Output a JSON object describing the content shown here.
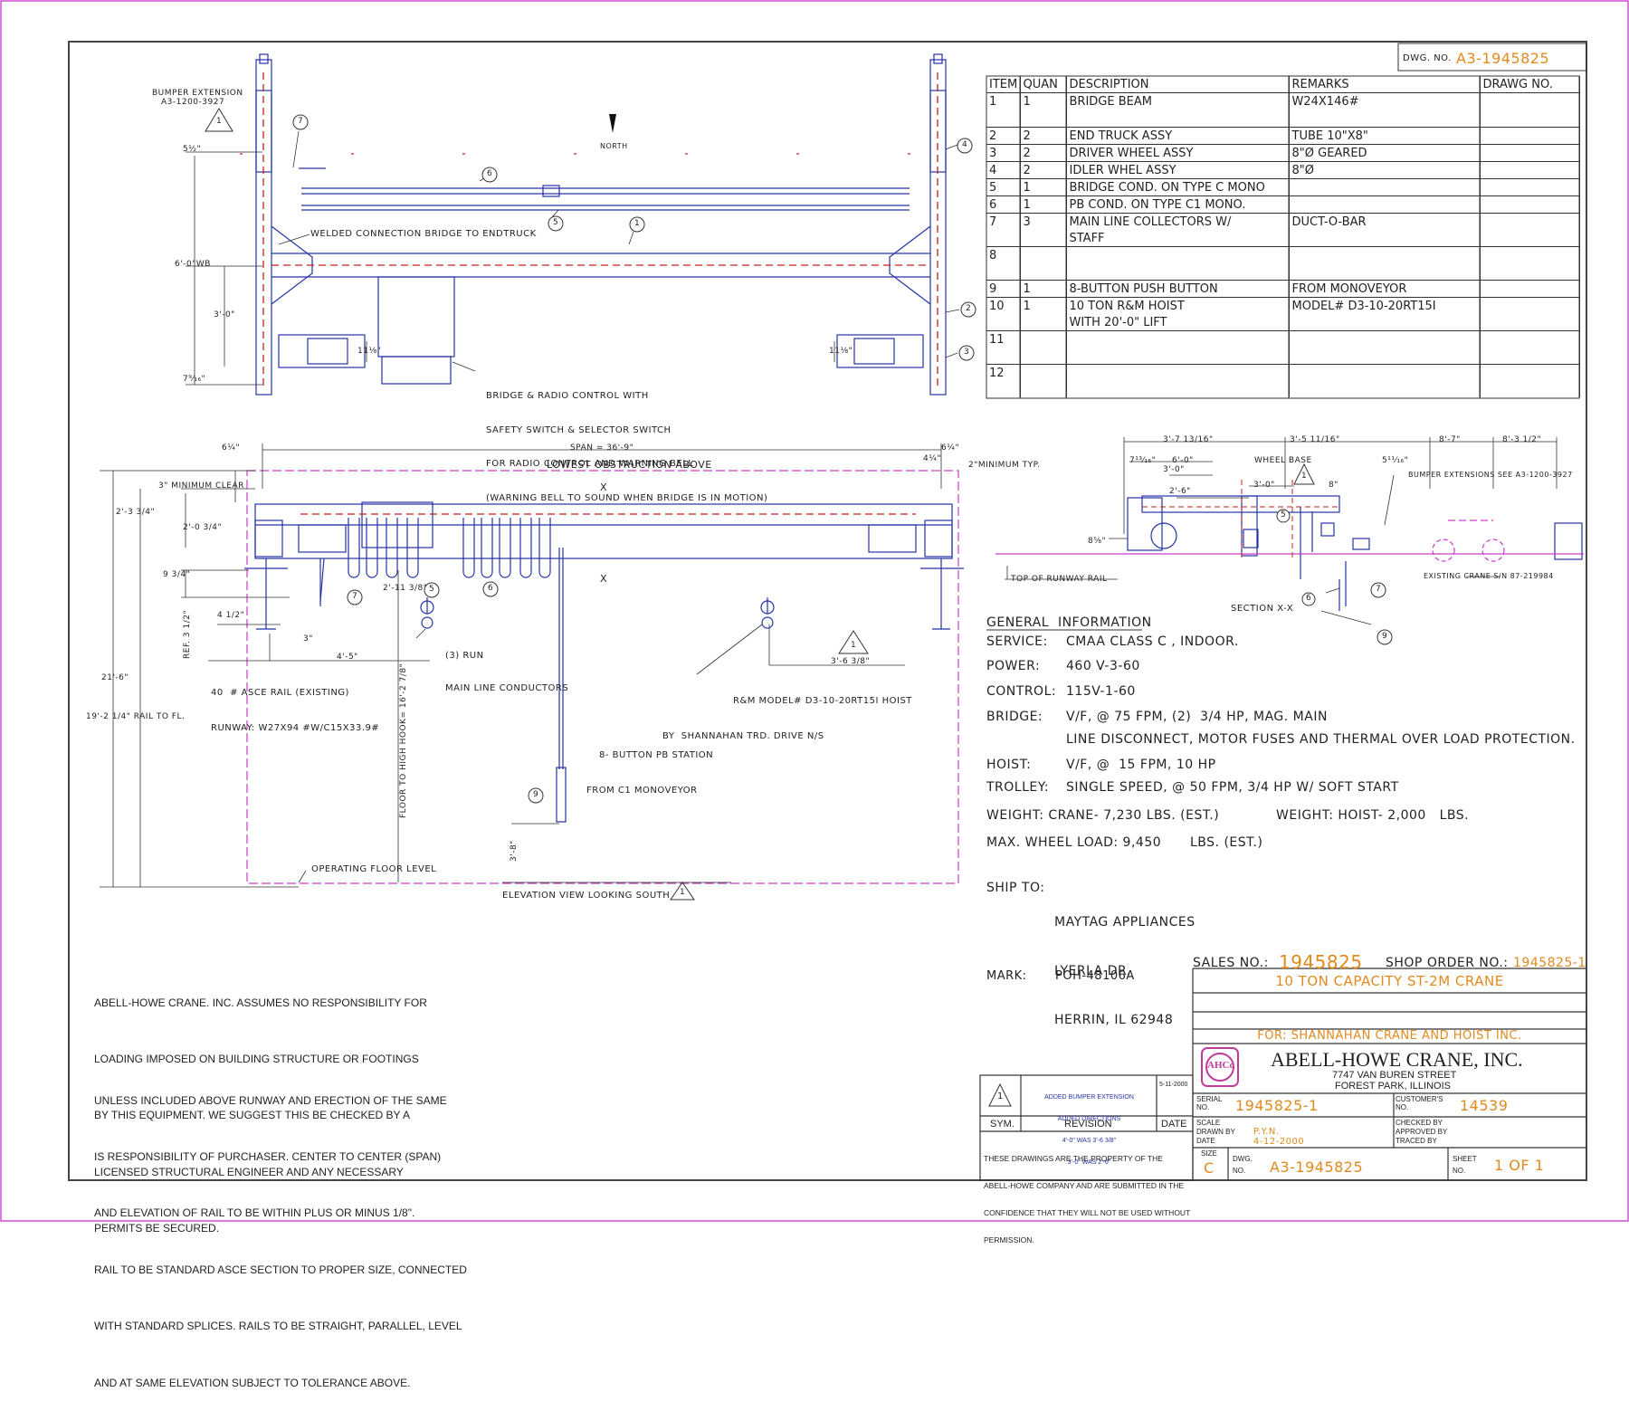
{
  "dwg_no_label": "DWG. NO.",
  "dwg_no": "A3-1945825",
  "parts_table": {
    "headers": [
      "ITEM",
      "QUAN",
      "DESCRIPTION",
      "REMARKS",
      "DRAWG NO."
    ],
    "rows": [
      {
        "item": "1",
        "quan": "1",
        "desc": "BRIDGE BEAM",
        "remarks": "W24X146#"
      },
      {
        "item": "",
        "quan": "",
        "desc": "",
        "remarks": ""
      },
      {
        "item": "2",
        "quan": "2",
        "desc": "END TRUCK ASSY",
        "remarks": "TUBE 10\"X8\""
      },
      {
        "item": "3",
        "quan": "2",
        "desc": "DRIVER WHEEL ASSY",
        "remarks": "8\"Ø GEARED"
      },
      {
        "item": "4",
        "quan": "2",
        "desc": "IDLER WHEL ASSY",
        "remarks": "8\"Ø"
      },
      {
        "item": "5",
        "quan": "1",
        "desc": "BRIDGE COND. ON TYPE C MONO",
        "remarks": ""
      },
      {
        "item": "6",
        "quan": "1",
        "desc": "PB COND. ON TYPE C1 MONO.",
        "remarks": ""
      },
      {
        "item": "7",
        "quan": "3",
        "desc": "MAIN LINE COLLECTORS W/",
        "remarks": "DUCT-O-BAR"
      },
      {
        "item": "",
        "quan": "",
        "desc": "STAFF",
        "remarks": ""
      },
      {
        "item": "8",
        "quan": "",
        "desc": "",
        "remarks": ""
      },
      {
        "item": "",
        "quan": "",
        "desc": "",
        "remarks": ""
      },
      {
        "item": "9",
        "quan": "1",
        "desc": "8-BUTTON PUSH BUTTON",
        "remarks": "FROM MONOVEYOR"
      },
      {
        "item": "10",
        "quan": "1",
        "desc": "10 TON R&M  HOIST",
        "remarks": "MODEL# D3-10-20RT15I"
      },
      {
        "item": "",
        "quan": "",
        "desc": "WITH 20'-0\"  LIFT",
        "remarks": ""
      },
      {
        "item": "11",
        "quan": "",
        "desc": "",
        "remarks": ""
      },
      {
        "item": "",
        "quan": "",
        "desc": "",
        "remarks": ""
      },
      {
        "item": "12",
        "quan": "",
        "desc": "",
        "remarks": ""
      },
      {
        "item": "",
        "quan": "",
        "desc": "",
        "remarks": ""
      }
    ]
  },
  "plan_view": {
    "bumper_ext": "BUMPER EXTENSION",
    "bumper_ext_ref": "A3-1200-3927",
    "north": "NORTH",
    "welded": "WELDED CONNECTION BRIDGE TO ENDTRUCK",
    "wb": "6'-0\"WB",
    "dim_3_0": "3'-0\"",
    "dim_5_half": "5½\"",
    "dim_7_9_16": "7⁹⁄₁₆\"",
    "dim_11_left": "11⅛\"",
    "dim_11_right": "11⅛\"",
    "control_note": [
      "BRIDGE & RADIO CONTROL WITH",
      "SAFETY SWITCH & SELECTOR SWITCH",
      "FOR RADIO CONTROL AND WARNING BELL",
      "(WARNING BELL TO SOUND WHEN BRIDGE IS IN MOTION)"
    ]
  },
  "elevation_view": {
    "span": "SPAN = 36'-9\"",
    "lowest": "LOWEST OBSTRUCTION ABOVE",
    "min_clear": "3\" MINIMUM CLEAR",
    "min_typ": "2\"MINIMUM TYP.",
    "d_6_1_4_l": "6¼\"",
    "d_6_1_4_r": "6¼\"",
    "d_4_1_4": "4¼\"",
    "d_2_3_3_4": "2'-3 3/4\"",
    "d_2_0_3_4": "2'-0 3/4\"",
    "d_9_3_4": "9 3/4\"",
    "d_4_1_2": "4 1/2\"",
    "d_3": "3\"",
    "ref": "REF. 3 1/2\"",
    "d_4_5": "4'-5\"",
    "d_2_11": "2'-11 3/8\"",
    "d_3_6_3_8": "3'-6 3/8\"",
    "d_21_6": "21'-6\"",
    "d_19": "19'-2 1/4\" RAIL TO FL.",
    "d_3_8": "3'-8\"",
    "floor_hook": "FLOOR TO HIGH HOOK= 16'-2 7/8\"",
    "x_mark": "X",
    "run_note": [
      "(3) RUN",
      "MAIN LINE CONDUCTORS"
    ],
    "rail_note": [
      "40  # ASCE RAIL (EXISTING)",
      "RUNWAY: W27X94 #W/C15X33.9#"
    ],
    "hoist_note": [
      "R&M MODEL# D3-10-20RT15I HOIST",
      "BY  SHANNAHAN TRD. DRIVE N/S"
    ],
    "pb_note": [
      "8- BUTTON PB STATION",
      "FROM C1 MONOVEYOR"
    ],
    "floor_level": "OPERATING FLOOR LEVEL",
    "caption": "ELEVATION VIEW LOOKING SOUTH"
  },
  "section_view": {
    "d_3_7": "3'-7 13/16\"",
    "d_3_5": "3'-5 11/16\"",
    "d_8_7": "8'-7\"",
    "d_8_3": "8'-3 1/2\"",
    "d_6_0": "6'-0\"",
    "d_3_0a": "3'-0\"",
    "d_2_6": "2'-6\"",
    "d_3_0b": "3'-0\"",
    "d_8": "8\"",
    "d_7_13": "7¹³⁄₁₆\"",
    "d_5_11": "5¹¹⁄₁₆\"",
    "d_8_5": "8⅝\"",
    "wheel_base": "WHEEL BASE",
    "bumper_ext_see": "BUMPER EXTENSIONS SEE A3-1200-3927",
    "existing": "EXISTING CRANE S/N 87-219984",
    "top_rail": "TOP OF RUNWAY RAIL",
    "caption": "SECTION X-X"
  },
  "general_info": {
    "heading": "GENERAL  INFORMATION",
    "lines": [
      {
        "k": "SERVICE:",
        "v": "CMAA CLASS C , INDOOR."
      },
      {
        "k": "POWER:",
        "v": "460 V-3-60"
      },
      {
        "k": "CONTROL:",
        "v": "115V-1-60"
      },
      {
        "k": "BRIDGE:",
        "v": "V/F, @ 75 FPM, (2)  3/4 HP, MAG. MAIN"
      },
      {
        "k": "",
        "v": "LINE DISCONNECT, MOTOR FUSES AND THERMAL OVER LOAD PROTECTION."
      },
      {
        "k": "HOIST:",
        "v": "V/F, @  15 FPM, 10 HP"
      },
      {
        "k": "TROLLEY:",
        "v": "SINGLE SPEED, @ 50 FPM, 3/4 HP W/ SOFT START"
      },
      {
        "k": "WEIGHT: CRANE- 7,230 LBS. (EST.)",
        "v": "WEIGHT: HOIST- 2,000   LBS."
      },
      {
        "k": "MAX. WHEEL LOAD: 9,450",
        "v": "LBS. (EST.)"
      }
    ],
    "ship_to_label": "SHIP TO:",
    "ship_to": [
      "MAYTAG APPLIANCES",
      "LYERLA DR.",
      "HERRIN, IL 62948"
    ],
    "mark_label": "MARK:",
    "mark": "POH-48106A"
  },
  "notes": {
    "p1": [
      "ABELL-HOWE CRANE. INC. ASSUMES NO RESPONSIBILITY FOR",
      "LOADING IMPOSED ON BUILDING STRUCTURE OR FOOTINGS",
      "BY THIS EQUIPMENT. WE SUGGEST THIS BE CHECKED BY A",
      "LICENSED STRUCTURAL ENGINEER AND ANY NECESSARY",
      "PERMITS BE SECURED."
    ],
    "p2": [
      "UNLESS INCLUDED ABOVE RUNWAY AND ERECTION OF THE SAME",
      "IS RESPONSIBILITY OF PURCHASER. CENTER TO CENTER (SPAN)",
      "AND ELEVATION OF RAIL TO BE WITHIN PLUS OR MINUS 1/8\".",
      "RAIL TO BE STANDARD ASCE SECTION TO PROPER SIZE, CONNECTED",
      "WITH STANDARD SPLICES. RAILS TO BE STRAIGHT, PARALLEL, LEVEL",
      "AND AT SAME ELEVATION SUBJECT TO TOLERANCE ABOVE."
    ]
  },
  "revision": {
    "sym": "1",
    "text": [
      "ADDED BUMPER EXTENSION",
      "ADDED DIRECTIONS",
      "4'-0\" WAS 3'-6 3/8\"",
      "3'-0\" WAS 2'-6\""
    ],
    "date": "5-11-2000",
    "sym_label": "SYM.",
    "rev_label": "REVISION",
    "date_label": "DATE",
    "property": [
      "THESE DRAWINGS ARE THE PROPERTY OF THE",
      "ABELL-HOWE COMPANY AND ARE SUBMITTED IN THE",
      "CONFIDENCE THAT THEY WILL NOT BE USED WITHOUT",
      "PERMISSION."
    ]
  },
  "title_block": {
    "sales_no_label": "SALES NO.:",
    "sales_no": "1945825",
    "shop_order_label": "SHOP ORDER NO.:",
    "shop_order": "1945825-1",
    "title": "10 TON CAPACITY ST-2M CRANE",
    "for": "FOR: SHANNAHAN CRANE AND HOIST INC.",
    "company": "ABELL-HOWE CRANE, INC.",
    "address1": "7747 VAN BUREN STREET",
    "address2": "FOREST PARK, ILLINOIS",
    "logo_text": "AHCo",
    "serial_label": "SERIAL NO.",
    "serial": "1945825-1",
    "customer_label": "CUSTOMER'S NO.",
    "customer": "14539",
    "scale_label": "SCALE",
    "drawn_label": "DRAWN BY",
    "drawn": "P.Y.N.",
    "date_label": "DATE",
    "date": "4-12-2000",
    "checked_label": "CHECKED BY",
    "approved_label": "APPROVED BY",
    "traced_label": "TRACED BY",
    "size_label": "SIZE",
    "size": "C",
    "dwg_label": "DWG. NO.",
    "dwg": "A3-1945825",
    "sheet_label": "SHEET NO.",
    "sheet": "1 OF 1"
  }
}
